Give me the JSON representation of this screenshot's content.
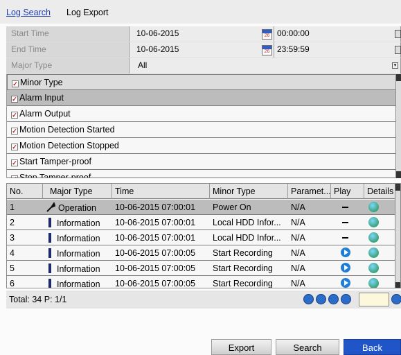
{
  "tabs": {
    "log_search": "Log Search",
    "log_export": "Log Export"
  },
  "conditions": {
    "start_time": {
      "label": "Start Time",
      "date": "10-06-2015",
      "time": "00:00:00",
      "cal_day": "26"
    },
    "end_time": {
      "label": "End Time",
      "date": "10-06-2015",
      "time": "23:59:59",
      "cal_day": "26"
    },
    "major_type": {
      "label": "Major Type",
      "value": "All"
    }
  },
  "minor_type": {
    "header": "Minor Type",
    "items": [
      "Alarm Input",
      "Alarm Output",
      "Motion Detection Started",
      "Motion Detection Stopped",
      "Start Tamper-proof",
      "Stop Tamper-proof"
    ]
  },
  "results": {
    "columns": [
      "No.",
      "Major Type",
      "Time",
      "Minor Type",
      "Paramet...",
      "Play",
      "Details"
    ],
    "rows": [
      {
        "no": "1",
        "major": "Operation",
        "time": "10-06-2015 07:00:01",
        "minor": "Power On",
        "param": "N/A",
        "play": "none"
      },
      {
        "no": "2",
        "major": "Information",
        "time": "10-06-2015 07:00:01",
        "minor": "Local HDD Infor...",
        "param": "N/A",
        "play": "none"
      },
      {
        "no": "3",
        "major": "Information",
        "time": "10-06-2015 07:00:01",
        "minor": "Local HDD Infor...",
        "param": "N/A",
        "play": "none"
      },
      {
        "no": "4",
        "major": "Information",
        "time": "10-06-2015 07:00:05",
        "minor": "Start Recording",
        "param": "N/A",
        "play": "play"
      },
      {
        "no": "5",
        "major": "Information",
        "time": "10-06-2015 07:00:05",
        "minor": "Start Recording",
        "param": "N/A",
        "play": "play"
      },
      {
        "no": "6",
        "major": "Information",
        "time": "10-06-2015 07:00:05",
        "minor": "Start Recording",
        "param": "N/A",
        "play": "play"
      }
    ]
  },
  "footer": {
    "total": "Total: 34  P: 1/1"
  },
  "buttons": {
    "export": "Export",
    "search": "Search",
    "back": "Back"
  },
  "colors": {
    "tab_active": "#1f3fb0",
    "back_button": "#1f55c8",
    "selected_row": "#bcbcbc"
  },
  "icons": {
    "operation": "wrench-icon",
    "information": "info-bar-icon",
    "play": "play-icon",
    "details": "details-globe-icon",
    "no_play": "dash-icon"
  }
}
